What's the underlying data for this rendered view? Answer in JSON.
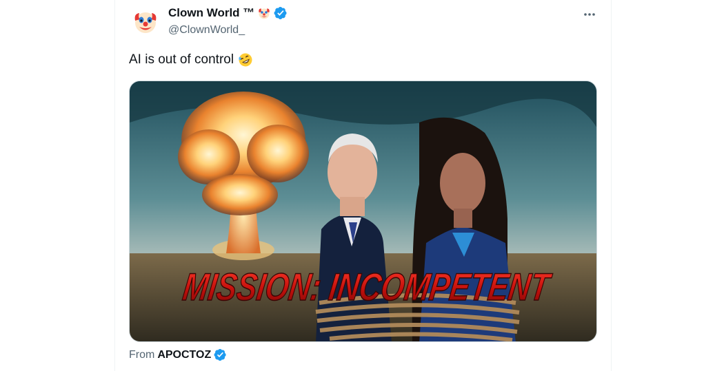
{
  "tweet": {
    "display_name": "Clown World ™",
    "handle": "@ClownWorld_",
    "text": "AI is out of control",
    "more_icon": "more-horizontal-icon",
    "verified_icon": "verified-badge-icon",
    "avatar_icon": "clown-face-icon",
    "text_emoji": "rolling-on-floor-laughing-emoji"
  },
  "media": {
    "title_text": "MISSION: INCOMPETENT"
  },
  "source": {
    "prefix": "From",
    "name": "APOCTOZ"
  },
  "colors": {
    "verified_blue": "#1d9bf0",
    "secondary_text": "#536471",
    "title_red": "#d4120e"
  }
}
